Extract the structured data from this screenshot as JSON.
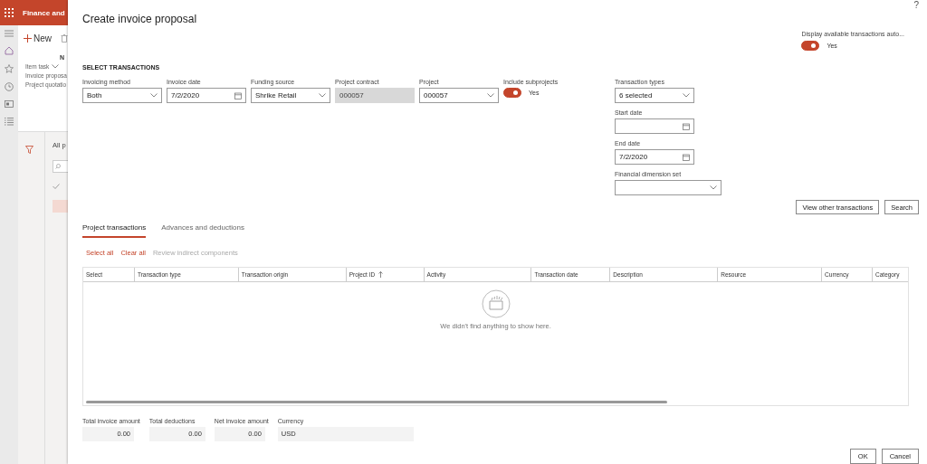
{
  "background_app": {
    "app_title": "Finance and",
    "new_button": "New",
    "column_label": "N",
    "task_menu": "Item task",
    "task_links": [
      "Invoice proposa",
      "Project quotatio"
    ],
    "page_title": "All p"
  },
  "dialog": {
    "title": "Create invoice proposal",
    "help": "?",
    "auto_display": {
      "label": "Display available transactions auto...",
      "on": true,
      "value": "Yes"
    },
    "section_heading": "SELECT TRANSACTIONS",
    "fields": [
      {
        "kind": "select",
        "label": "Invoicing method",
        "value": "Both"
      },
      {
        "kind": "date",
        "label": "Invoice date",
        "value": "7/2/2020"
      },
      {
        "kind": "select",
        "label": "Funding source",
        "value": "Shrike Retail"
      },
      {
        "kind": "readonly",
        "label": "Project contract",
        "value": "000057"
      },
      {
        "kind": "select",
        "label": "Project",
        "value": "000057"
      },
      {
        "kind": "toggle",
        "label": "Include subprojects",
        "on": true,
        "value": "Yes"
      }
    ],
    "side_fields": [
      {
        "kind": "select",
        "label": "Transaction types",
        "value": "6 selected"
      },
      {
        "kind": "date",
        "label": "Start date"
      },
      {
        "kind": "date",
        "label": "End date",
        "value": "7/2/2020"
      },
      {
        "kind": "wideselect",
        "label": "Financial dimension set"
      }
    ],
    "search_buttons": [
      "View other transactions",
      "Search"
    ],
    "tabs": [
      {
        "label": "Project transactions",
        "selected": true
      },
      {
        "label": "Advances and deductions",
        "selected": false
      }
    ],
    "grid_actions": [
      {
        "label": "Select all",
        "disabled": false
      },
      {
        "label": "Clear all",
        "disabled": false
      },
      {
        "label": "Review indirect components",
        "disabled": true
      }
    ],
    "columns": [
      {
        "label": "Select",
        "sorted": false
      },
      {
        "label": "Transaction type",
        "sorted": false
      },
      {
        "label": "Transaction origin",
        "sorted": false
      },
      {
        "label": "Project ID",
        "sorted": true
      },
      {
        "label": "Activity",
        "sorted": false
      },
      {
        "label": "Transaction date",
        "sorted": false
      },
      {
        "label": "Description",
        "sorted": false
      },
      {
        "label": "Resource",
        "sorted": false
      },
      {
        "label": "Currency",
        "sorted": false
      },
      {
        "label": "Category",
        "sorted": false
      }
    ],
    "empty_message": "We didn't find anything to show here.",
    "totals": [
      {
        "label": "Total invoice amount",
        "value": "0.00",
        "kind": "number"
      },
      {
        "label": "Total deductions",
        "value": "0.00",
        "kind": "number"
      },
      {
        "label": "Net invoice amount",
        "value": "0.00",
        "kind": "number"
      },
      {
        "label": "Currency",
        "value": "USD",
        "kind": "text"
      }
    ],
    "footer_buttons": [
      "OK",
      "Cancel"
    ]
  }
}
